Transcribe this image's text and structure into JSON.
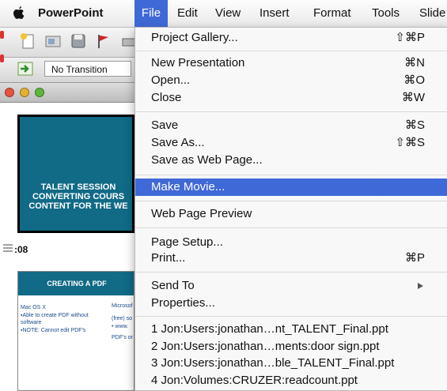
{
  "menubar": {
    "apple_icon": "apple-logo-icon",
    "app_name": "PowerPoint",
    "menus": [
      "File",
      "Edit",
      "View",
      "Insert",
      "Format",
      "Tools",
      "Slide"
    ],
    "active_menu": "File"
  },
  "toolbar": {
    "transition_value": "No Transition",
    "icons": [
      "new-file-icon",
      "gallery-icon",
      "save-icon",
      "flag-icon",
      "print-icon",
      "transition-icon"
    ]
  },
  "slides_panel": {
    "thumb1_lines": [
      "TALENT SESSION",
      "CONVERTING COURS",
      "CONTENT FOR THE WE"
    ],
    "thumb_label": ":08",
    "thumb2_header": "CREATING A PDF",
    "thumb2_text": [
      "Mac OS X",
      "▪Able to create PDF without",
      "software",
      "▪NOTE: Cannot edit PDF's",
      "Microsof",
      "(free) so",
      "• www.",
      "PDF's or"
    ]
  },
  "file_menu": {
    "items": [
      {
        "label": "Project Gallery...",
        "shortcut": "⇧⌘P"
      },
      {
        "label": "New Presentation",
        "shortcut": "⌘N"
      },
      {
        "label": "Open...",
        "shortcut": "⌘O"
      },
      {
        "label": "Close",
        "shortcut": "⌘W"
      },
      {
        "label": "Save",
        "shortcut": "⌘S"
      },
      {
        "label": "Save As...",
        "shortcut": "⇧⌘S"
      },
      {
        "label": "Save as Web Page...",
        "shortcut": ""
      },
      {
        "label": "Make Movie...",
        "shortcut": "",
        "highlighted": true
      },
      {
        "label": "Web Page Preview",
        "shortcut": ""
      },
      {
        "label": "Page Setup...",
        "shortcut": ""
      },
      {
        "label": "Print...",
        "shortcut": "⌘P"
      },
      {
        "label": "Send To",
        "shortcut": "",
        "submenu": true
      },
      {
        "label": "Properties...",
        "shortcut": ""
      },
      {
        "label": "1 Jon:Users:jonathan…nt_TALENT_Final.ppt",
        "shortcut": ""
      },
      {
        "label": "2 Jon:Users:jonathan…ments:door sign.ppt",
        "shortcut": ""
      },
      {
        "label": "3 Jon:Users:jonathan…ble_TALENT_Final.ppt",
        "shortcut": ""
      },
      {
        "label": "4 Jon:Volumes:CRUZER:readcount.ppt",
        "shortcut": ""
      }
    ]
  },
  "colors": {
    "highlight": "#3f69d6",
    "slide_teal": "#116a86"
  }
}
